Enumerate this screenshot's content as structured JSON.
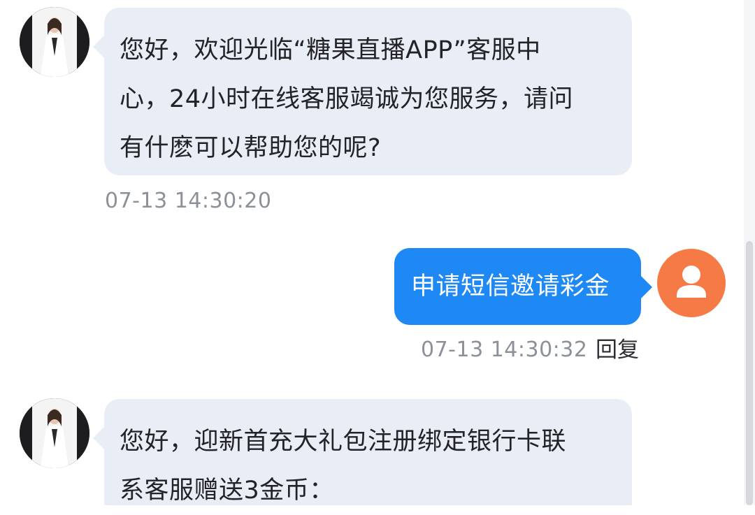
{
  "messages": [
    {
      "direction": "incoming",
      "sender_avatar": "agent-photo",
      "text": "您好，欢迎光临“糖果直播APP”客服中\n心，24小时在线客服竭诚为您服务，请问\n有什麽可以帮助您的呢?",
      "time": "07-13 14:30:20"
    },
    {
      "direction": "outgoing",
      "sender_avatar": "user-icon",
      "text": "申请短信邀请彩金",
      "time": "07-13 14:30:32",
      "reply_label": "回复"
    },
    {
      "direction": "incoming",
      "sender_avatar": "agent-photo",
      "text": "您好，迎新首充大礼包注册绑定银行卡联\n系客服赠送3金币："
    }
  ],
  "colors": {
    "incoming_bubble": "#e9edf5",
    "outgoing_bubble": "#1e88f5",
    "user_avatar": "#f57a45",
    "timestamp": "#8c9099"
  }
}
